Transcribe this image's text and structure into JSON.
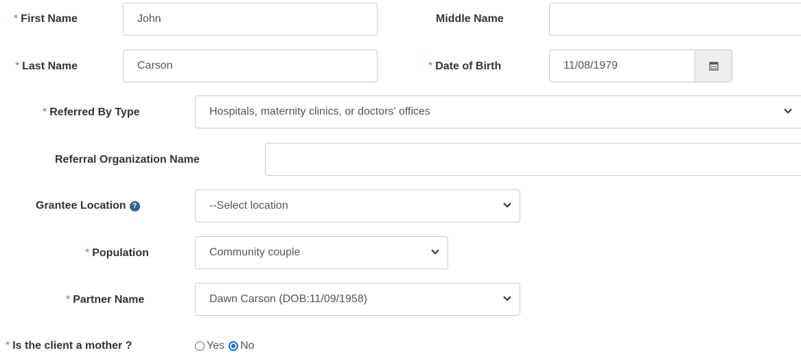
{
  "required_mark": "*",
  "fields": {
    "first_name": {
      "label": "First Name",
      "value": "John"
    },
    "middle_name": {
      "label": "Middle Name",
      "value": ""
    },
    "last_name": {
      "label": "Last Name",
      "value": "Carson"
    },
    "dob": {
      "label": "Date of Birth",
      "value": "11/08/1979",
      "icon": "calendar-icon"
    },
    "referred_by_type": {
      "label": "Referred By Type",
      "value": "Hospitals, maternity clinics, or doctors’ offices"
    },
    "referral_org": {
      "label": "Referral Organization Name",
      "value": ""
    },
    "grantee_location": {
      "label": "Grantee Location",
      "value": "--Select location",
      "icon": "question-circle-icon"
    },
    "population": {
      "label": "Population",
      "value": "Community couple"
    },
    "partner_name": {
      "label": "Partner Name",
      "value": "Dawn Carson (DOB:11/09/1958)"
    },
    "is_mother": {
      "label": "Is the client a mother ?",
      "options": [
        "Yes",
        "No"
      ],
      "selected": "No"
    }
  },
  "colors": {
    "required": "#d9534f",
    "radio_selected": "#0a6fe0",
    "help_icon": "#2f5f8a"
  }
}
